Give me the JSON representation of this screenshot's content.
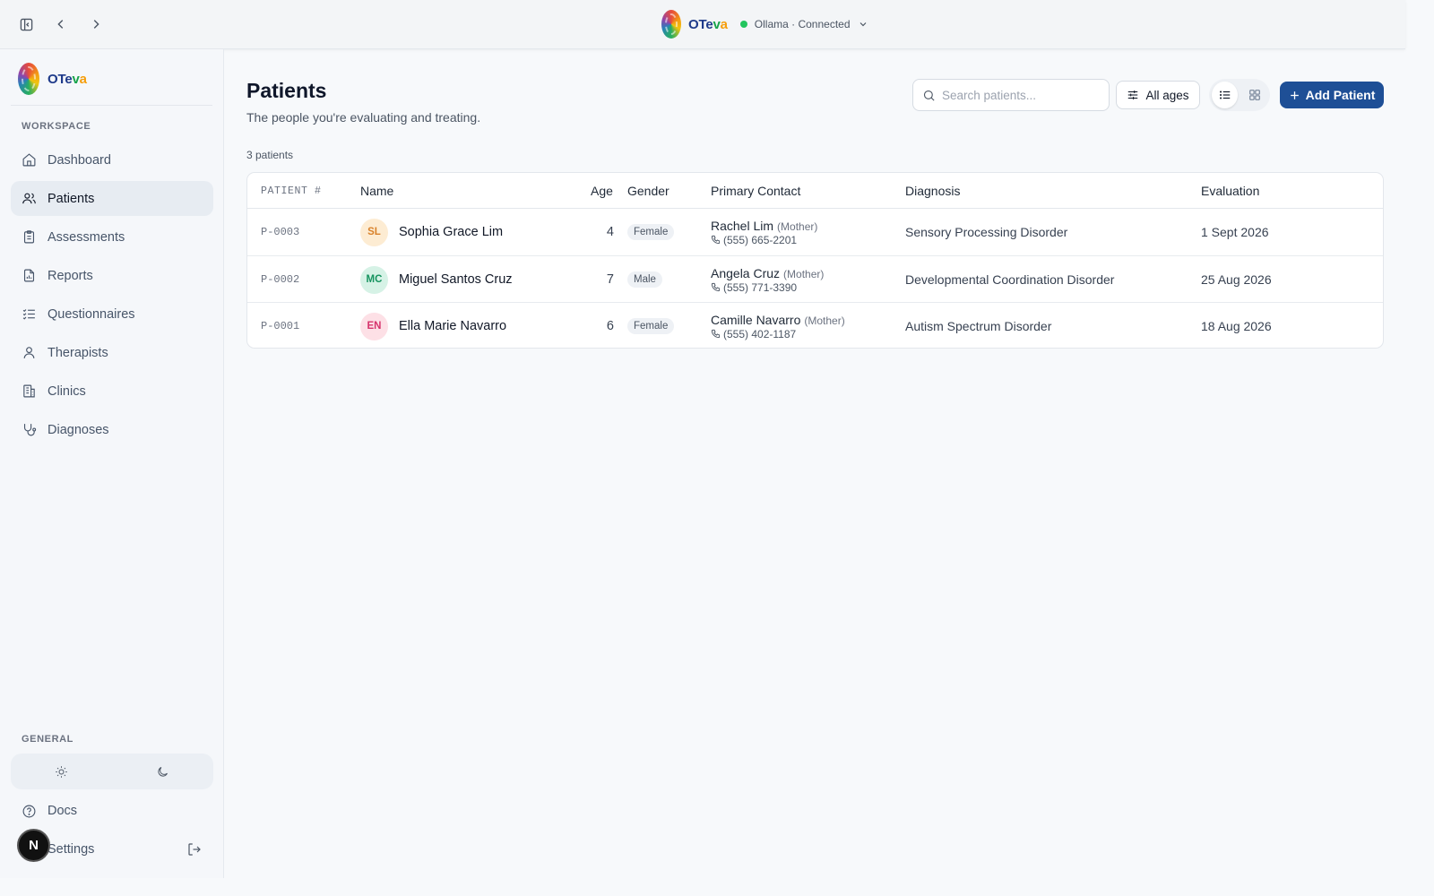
{
  "topbar": {
    "brand": {
      "p1": "O",
      "p2": "Te",
      "p3": "v",
      "p4": "a"
    },
    "status": "Ollama · Connected"
  },
  "sidebar": {
    "brand": {
      "p1": "O",
      "p2": "Te",
      "p3": "v",
      "p4": "a"
    },
    "workspace_label": "WORKSPACE",
    "items": [
      {
        "label": "Dashboard",
        "icon": "home-icon"
      },
      {
        "label": "Patients",
        "icon": "users-icon",
        "active": true
      },
      {
        "label": "Assessments",
        "icon": "clipboard-icon"
      },
      {
        "label": "Reports",
        "icon": "file-chart-icon"
      },
      {
        "label": "Questionnaires",
        "icon": "checklist-icon"
      },
      {
        "label": "Therapists",
        "icon": "user-icon"
      },
      {
        "label": "Clinics",
        "icon": "building-icon"
      },
      {
        "label": "Diagnoses",
        "icon": "stethoscope-icon"
      }
    ],
    "general_label": "GENERAL",
    "docs": "Docs",
    "settings": "Settings",
    "avatar_initial": "N"
  },
  "main": {
    "title": "Patients",
    "subtitle": "The people you're evaluating and treating.",
    "search_placeholder": "Search patients...",
    "filter_label": "All ages",
    "add_label": "Add Patient",
    "count": "3 patients",
    "columns": {
      "id": "PATIENT #",
      "name": "Name",
      "age": "Age",
      "gender": "Gender",
      "contact": "Primary Contact",
      "diagnosis": "Diagnosis",
      "evaluation": "Evaluation"
    },
    "rows": [
      {
        "id": "P-0003",
        "initials": "SL",
        "name": "Sophia Grace Lim",
        "age": "4",
        "gender": "Female",
        "contact_name": "Rachel Lim",
        "contact_rel": "(Mother)",
        "phone": "(555) 665-2201",
        "diagnosis": "Sensory Processing Disorder",
        "evaluation": "1 Sept 2026",
        "avatar_bg": "#fdecd3",
        "avatar_fg": "#d9822b"
      },
      {
        "id": "P-0002",
        "initials": "MC",
        "name": "Miguel Santos Cruz",
        "age": "7",
        "gender": "Male",
        "contact_name": "Angela Cruz",
        "contact_rel": "(Mother)",
        "phone": "(555) 771-3390",
        "diagnosis": "Developmental Coordination Disorder",
        "evaluation": "25 Aug 2026",
        "avatar_bg": "#d6f2e6",
        "avatar_fg": "#15935f"
      },
      {
        "id": "P-0001",
        "initials": "EN",
        "name": "Ella Marie Navarro",
        "age": "6",
        "gender": "Female",
        "contact_name": "Camille Navarro",
        "contact_rel": "(Mother)",
        "phone": "(555) 402-1187",
        "diagnosis": "Autism Spectrum Disorder",
        "evaluation": "18 Aug 2026",
        "avatar_bg": "#fde0e6",
        "avatar_fg": "#d6336c"
      }
    ]
  },
  "colors": {
    "primary": "#1e4f96",
    "status_ok": "#22c55e",
    "active_nav": "#e7ecf2"
  }
}
